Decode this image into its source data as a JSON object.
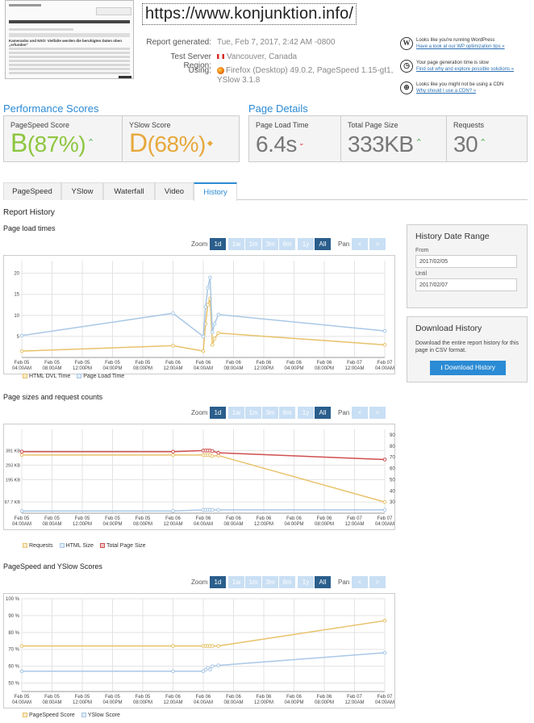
{
  "header": {
    "url": "https://www.konjunktion.info/",
    "report_generated_label": "Report generated:",
    "report_generated_value": "Tue, Feb 7, 2017, 2:42 AM -0800",
    "region_label": "Test Server Region:",
    "region_value": "Vancouver, Canada",
    "using_label": "Using:",
    "using_value_1": "Firefox (Desktop) 49.0.2, PageSpeed 1.15-gt1,",
    "using_value_2": "YSlow 3.1.8"
  },
  "thumbnail": {
    "headline": "Kameraobs und NSO: Vielfalte werden die beruhigten Daten oben „erfunden\""
  },
  "tips": [
    {
      "icon": "wordpress-icon",
      "text": "Looks like you're running WordPress",
      "link": "Have a look at our WP optimization tips »"
    },
    {
      "icon": "stopwatch-icon",
      "text": "Your page generation time is slow",
      "link": "Find out why and explore possible solutions »"
    },
    {
      "icon": "globe-icon",
      "text": "Looks like you might not be using a CDN",
      "link": "Why should I use a CDN? »"
    }
  ],
  "performance": {
    "heading": "Performance Scores",
    "pagespeed_label": "PageSpeed Score",
    "pagespeed_grade": "B",
    "pagespeed_pct": "(87%)",
    "yslow_label": "YSlow Score",
    "yslow_grade": "D",
    "yslow_pct": "(68%)"
  },
  "details": {
    "heading": "Page Details",
    "load_label": "Page Load Time",
    "load_value": "6.4s",
    "size_label": "Total Page Size",
    "size_value": "333KB",
    "req_label": "Requests",
    "req_value": "30"
  },
  "tabs": [
    "PageSpeed",
    "YSlow",
    "Waterfall",
    "Video",
    "History"
  ],
  "active_tab": "History",
  "report_history": "Report History",
  "controls": {
    "zoom_label": "Zoom",
    "zoom_options": [
      "1d",
      "1w",
      "1m",
      "3m",
      "6m",
      "1y",
      "All"
    ],
    "pan_label": "Pan",
    "pan_left": "<",
    "pan_right": ">"
  },
  "x_ticks": [
    [
      "Feb 05",
      "04:00AM"
    ],
    [
      "Feb 05",
      "08:00AM"
    ],
    [
      "Feb 05",
      "12:00PM"
    ],
    [
      "Feb 05",
      "04:00PM"
    ],
    [
      "Feb 05",
      "08:00PM"
    ],
    [
      "Feb 06",
      "12:00AM"
    ],
    [
      "Feb 06",
      "04:00AM"
    ],
    [
      "Feb 06",
      "08:00AM"
    ],
    [
      "Feb 06",
      "12:00PM"
    ],
    [
      "Feb 06",
      "04:00PM"
    ],
    [
      "Feb 06",
      "08:00PM"
    ],
    [
      "Feb 07",
      "12:00AM"
    ],
    [
      "Feb 07",
      "04:00AM"
    ]
  ],
  "colors": {
    "yellow": "#e8c26a",
    "blue": "#a9c8e6",
    "red": "#cf4f4f",
    "accent": "#2b8bd4"
  },
  "chart_data": [
    {
      "type": "line",
      "title": "Page load times",
      "x_range": [
        "Feb 05 04:00AM",
        "Feb 07 04:00AM"
      ],
      "yticks": [
        "5",
        "10",
        "15",
        "20"
      ],
      "ylim": [
        0,
        23
      ],
      "series": [
        {
          "name": "HTML DVL Time",
          "color": "#e8c26a",
          "x": [
            0,
            20,
            24,
            24.3,
            24.6,
            24.9,
            25.2,
            25.5,
            26,
            48
          ],
          "y": [
            1.5,
            2.8,
            1.5,
            8,
            12.5,
            14,
            3,
            4.5,
            5.8,
            3
          ]
        },
        {
          "name": "Page Load Time",
          "color": "#a9c8e6",
          "x": [
            0,
            20,
            24,
            24.3,
            24.6,
            24.9,
            25.2,
            25.5,
            26,
            48
          ],
          "y": [
            5.2,
            10.5,
            5,
            12,
            16.5,
            19,
            6,
            8,
            10.2,
            6.3
          ]
        }
      ]
    },
    {
      "type": "line",
      "title": "Page sizes and request counts",
      "x_range": [
        "Feb 05 04:00AM",
        "Feb 07 04:00AM"
      ],
      "yticks_left": [
        "97.7 KB",
        "195 KB",
        "293 KB",
        "391 KB"
      ],
      "yticks_right": [
        "30",
        "40",
        "50",
        "60",
        "70",
        "80",
        "90"
      ],
      "series": [
        {
          "name": "Requests",
          "color": "#e8c26a",
          "x": [
            0,
            20,
            24,
            24.3,
            24.6,
            24.9,
            25.2,
            26,
            48
          ],
          "y": [
            72,
            72,
            72,
            72,
            72,
            72,
            71,
            71.5,
            30
          ]
        },
        {
          "name": "HTML Size",
          "color": "#a9c8e6",
          "x": [
            0,
            20,
            24,
            24.3,
            24.6,
            24.9,
            25.2,
            26,
            48
          ],
          "y": [
            22,
            22,
            23,
            23,
            23,
            23,
            23,
            23,
            23
          ]
        },
        {
          "name": "Total Page Size",
          "color": "#cf4f4f",
          "x": [
            0,
            20,
            24,
            24.3,
            24.6,
            24.9,
            25.2,
            26,
            48
          ],
          "y": [
            75,
            75,
            76,
            76,
            76,
            76,
            75.5,
            74,
            68
          ]
        }
      ]
    },
    {
      "type": "line",
      "title": "PageSpeed and YSlow Scores",
      "x_range": [
        "Feb 05 04:00AM",
        "Feb 07 04:00AM"
      ],
      "yticks": [
        "50 %",
        "60 %",
        "70 %",
        "80 %",
        "90 %",
        "100 %"
      ],
      "ylim": [
        45,
        100
      ],
      "series": [
        {
          "name": "PageSpeed Score",
          "color": "#e8c26a",
          "x": [
            0,
            20,
            24,
            24.3,
            24.6,
            24.9,
            25.2,
            26,
            48
          ],
          "y": [
            72,
            72,
            72,
            72,
            72,
            72,
            72,
            72,
            87
          ]
        },
        {
          "name": "YSlow Score",
          "color": "#a9c8e6",
          "x": [
            0,
            20,
            24,
            24.3,
            24.6,
            24.9,
            25.2,
            26,
            48
          ],
          "y": [
            57,
            57,
            57,
            58,
            59,
            58,
            60,
            60.5,
            68
          ]
        }
      ]
    }
  ],
  "history_range": {
    "title": "History Date Range",
    "from_label": "From",
    "from_value": "2017/02/05",
    "until_label": "Until",
    "until_value": "2017/02/07"
  },
  "download": {
    "title": "Download History",
    "text": "Download the entire report history for this page in CSV format.",
    "button": "Download History"
  }
}
